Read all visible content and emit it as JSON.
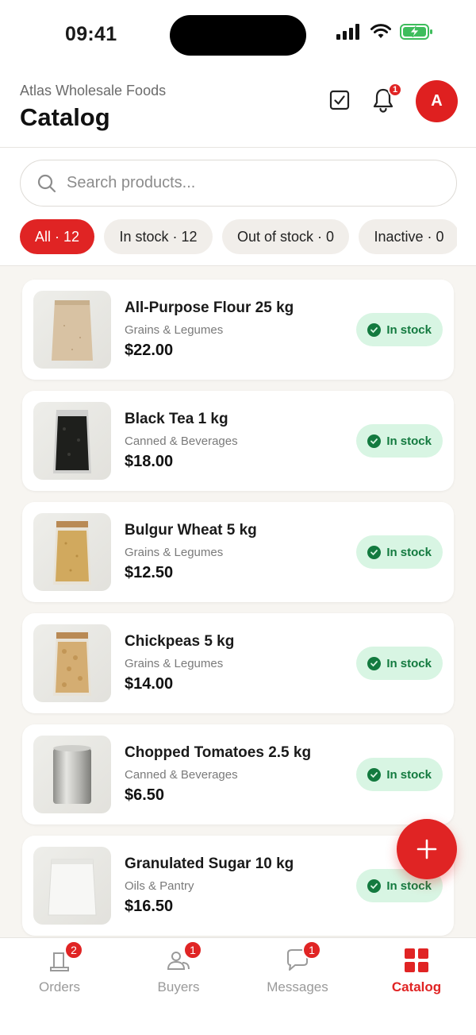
{
  "status_bar": {
    "time": "09:41",
    "icons": [
      "signal-icon",
      "wifi-icon",
      "battery-charging-icon"
    ]
  },
  "header": {
    "company": "Atlas Wholesale Foods",
    "title": "Catalog",
    "notification_count": "1",
    "avatar_initial": "A"
  },
  "search": {
    "placeholder": "Search products..."
  },
  "filters": [
    {
      "label": "All · 12",
      "active": true
    },
    {
      "label": "In stock · 12",
      "active": false
    },
    {
      "label": "Out of stock · 0",
      "active": false
    },
    {
      "label": "Inactive · 0",
      "active": false
    }
  ],
  "products": [
    {
      "name": "All-Purpose Flour 25 kg",
      "category": "Grains & Legumes",
      "price": "$22.00",
      "status": "In stock",
      "image": "flour-sack"
    },
    {
      "name": "Black Tea 1 kg",
      "category": "Canned & Beverages",
      "price": "$18.00",
      "status": "In stock",
      "image": "tea-bag"
    },
    {
      "name": "Bulgur Wheat 5 kg",
      "category": "Grains & Legumes",
      "price": "$12.50",
      "status": "In stock",
      "image": "bulgur-bag"
    },
    {
      "name": "Chickpeas 5 kg",
      "category": "Grains & Legumes",
      "price": "$14.00",
      "status": "In stock",
      "image": "chickpea-bag"
    },
    {
      "name": "Chopped Tomatoes 2.5 kg",
      "category": "Canned & Beverages",
      "price": "$6.50",
      "status": "In stock",
      "image": "tin-can"
    },
    {
      "name": "Granulated Sugar 10 kg",
      "category": "Oils & Pantry",
      "price": "$16.50",
      "status": "In stock",
      "image": "sugar-sack"
    }
  ],
  "bottom_nav": [
    {
      "label": "Orders",
      "badge": "2",
      "active": false,
      "icon": "orders-icon"
    },
    {
      "label": "Buyers",
      "badge": "1",
      "active": false,
      "icon": "buyers-icon"
    },
    {
      "label": "Messages",
      "badge": "1",
      "active": false,
      "icon": "messages-icon"
    },
    {
      "label": "Catalog",
      "badge": "",
      "active": true,
      "icon": "catalog-grid-icon"
    }
  ],
  "colors": {
    "accent": "#e02424",
    "success_bg": "#d8f5e3",
    "success_text": "#137a3f",
    "list_bg": "#f7f5f1"
  }
}
